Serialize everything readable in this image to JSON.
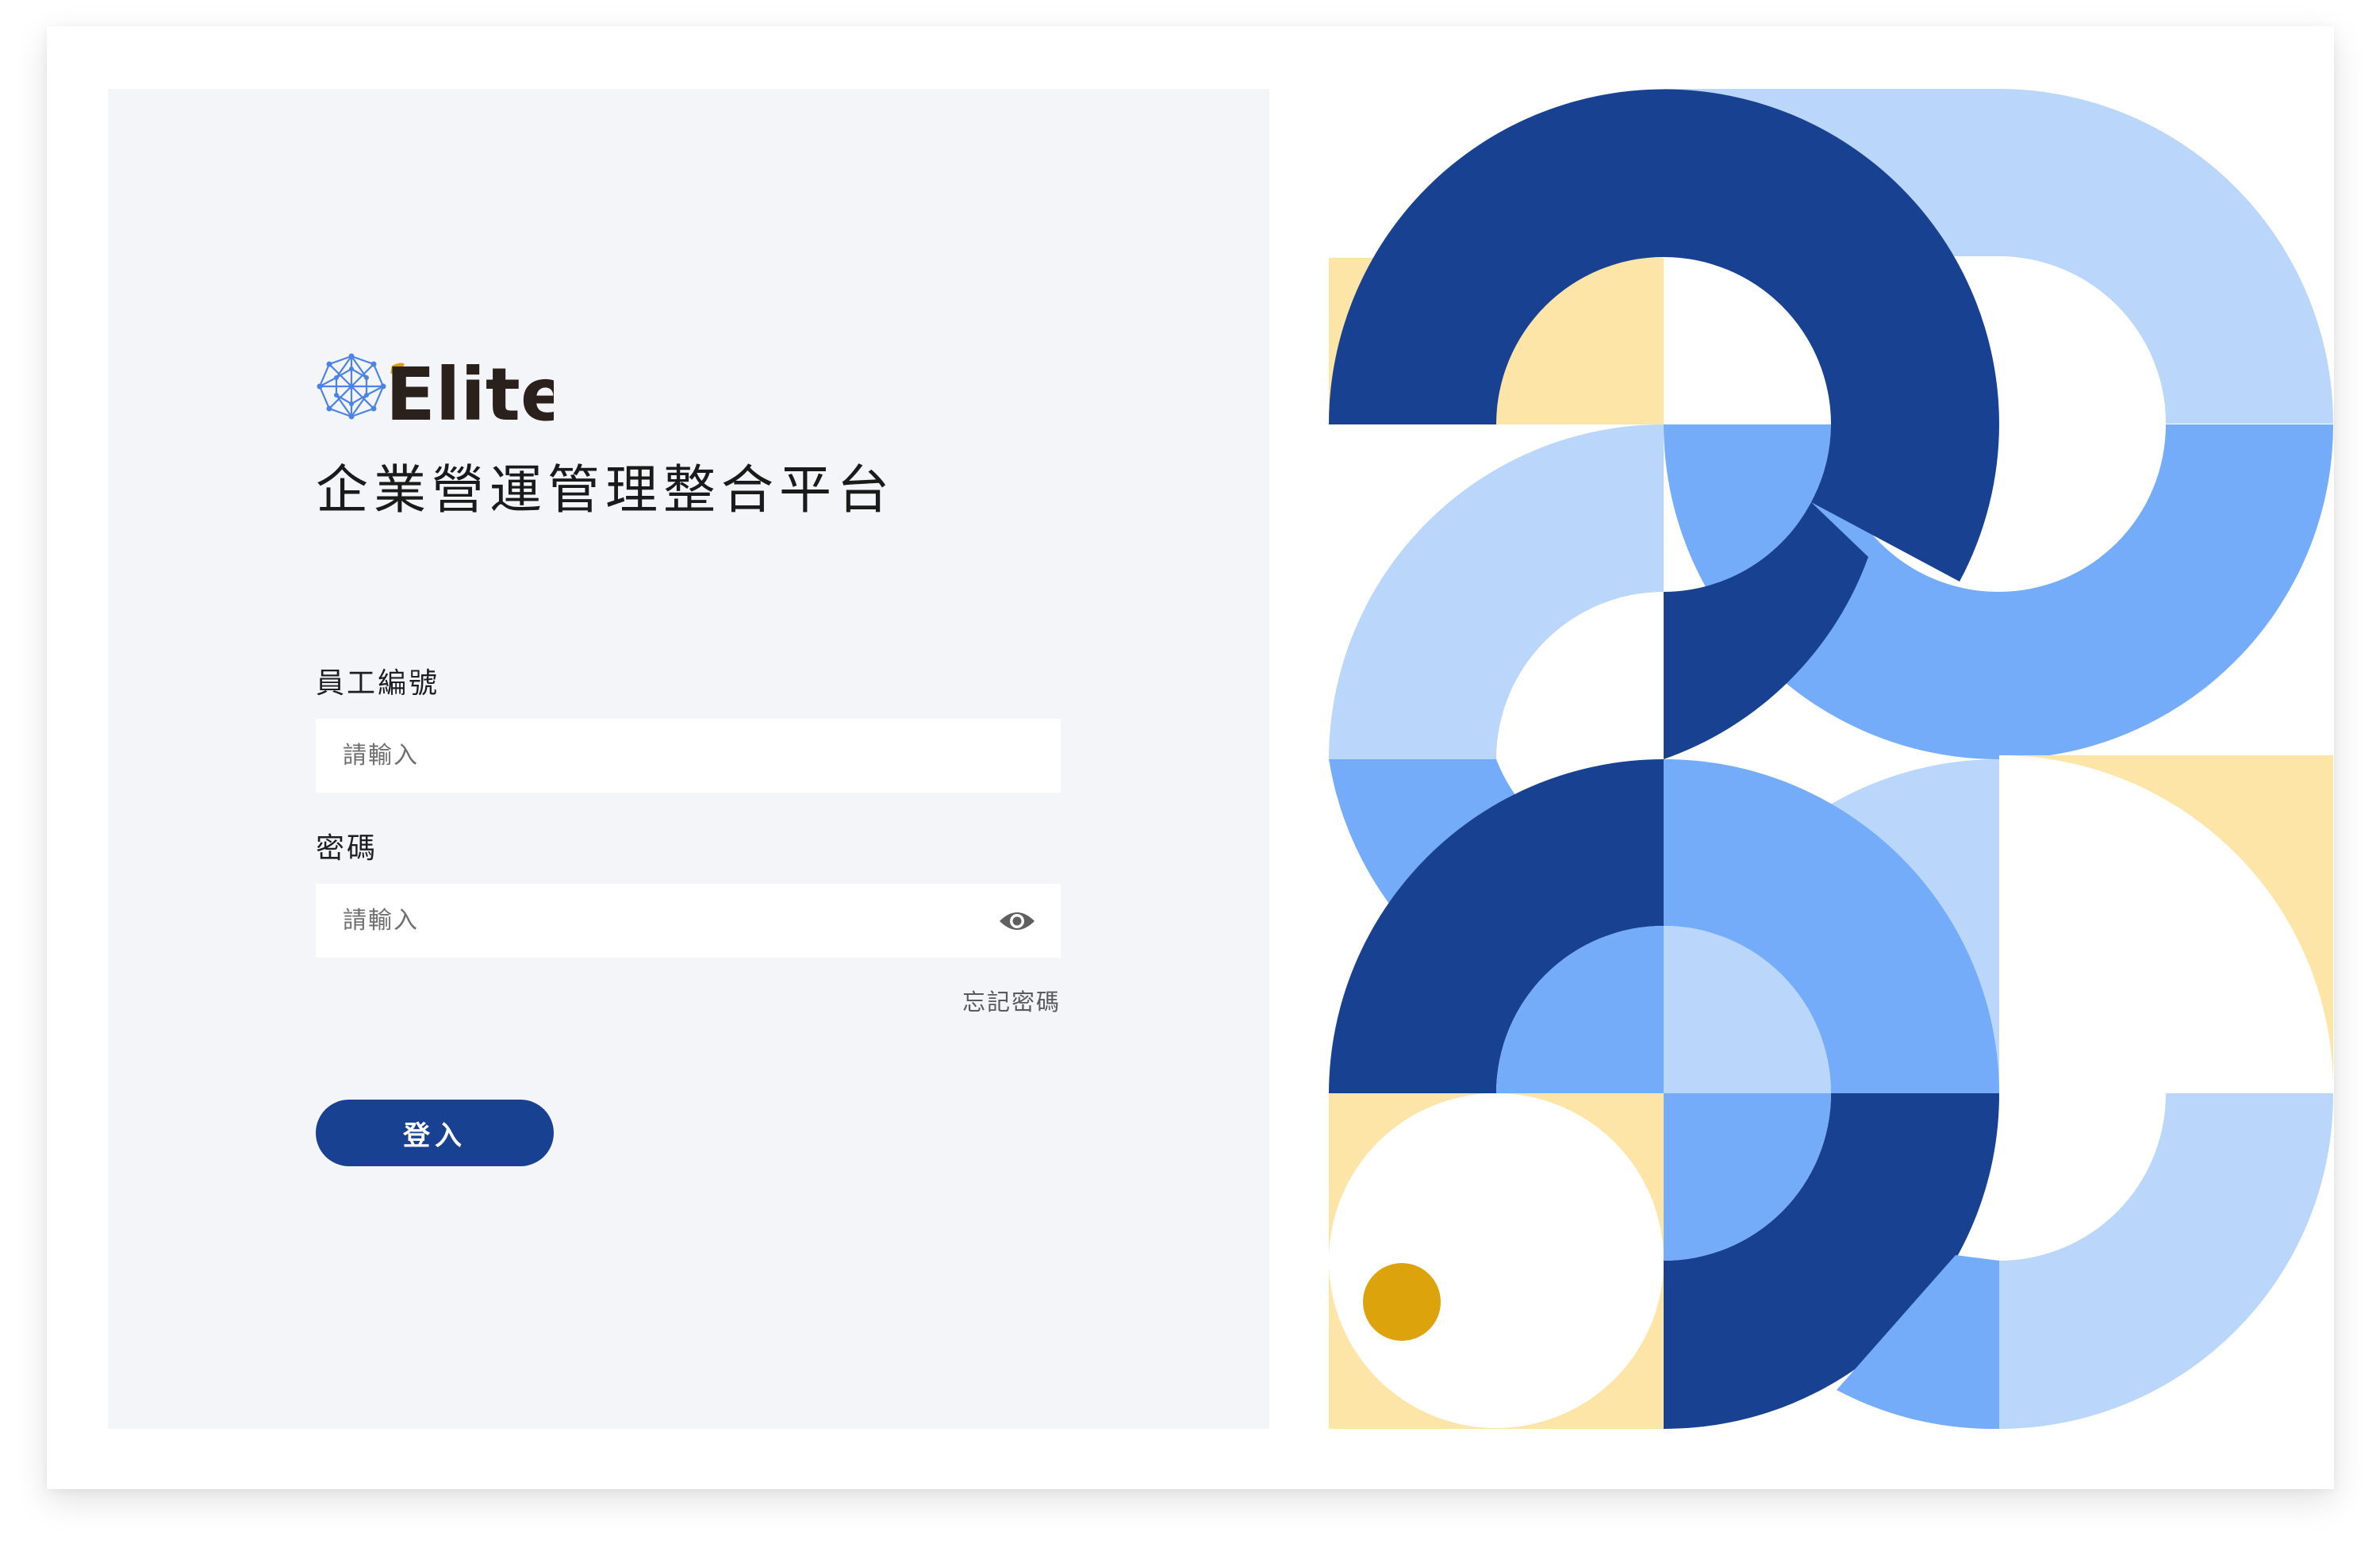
{
  "brand": {
    "logo_text": "Elite",
    "app_title": "企業營運管理整合平台"
  },
  "login_form": {
    "employee_id": {
      "label": "員工編號",
      "placeholder": "請輸入",
      "value": ""
    },
    "password": {
      "label": "密碼",
      "placeholder": "請輸入",
      "value": "",
      "toggle_icon": "eye-icon"
    },
    "forgot_password_label": "忘記密碼",
    "submit_label": "登入"
  },
  "colors": {
    "primary": "#184192",
    "panel_background": "#f4f5f9",
    "pattern_navy": "#184192",
    "pattern_mid_blue": "#74acfa",
    "pattern_light_blue": "#bad6fa",
    "pattern_cream": "#fde5a7",
    "pattern_gold": "#dca30c"
  }
}
